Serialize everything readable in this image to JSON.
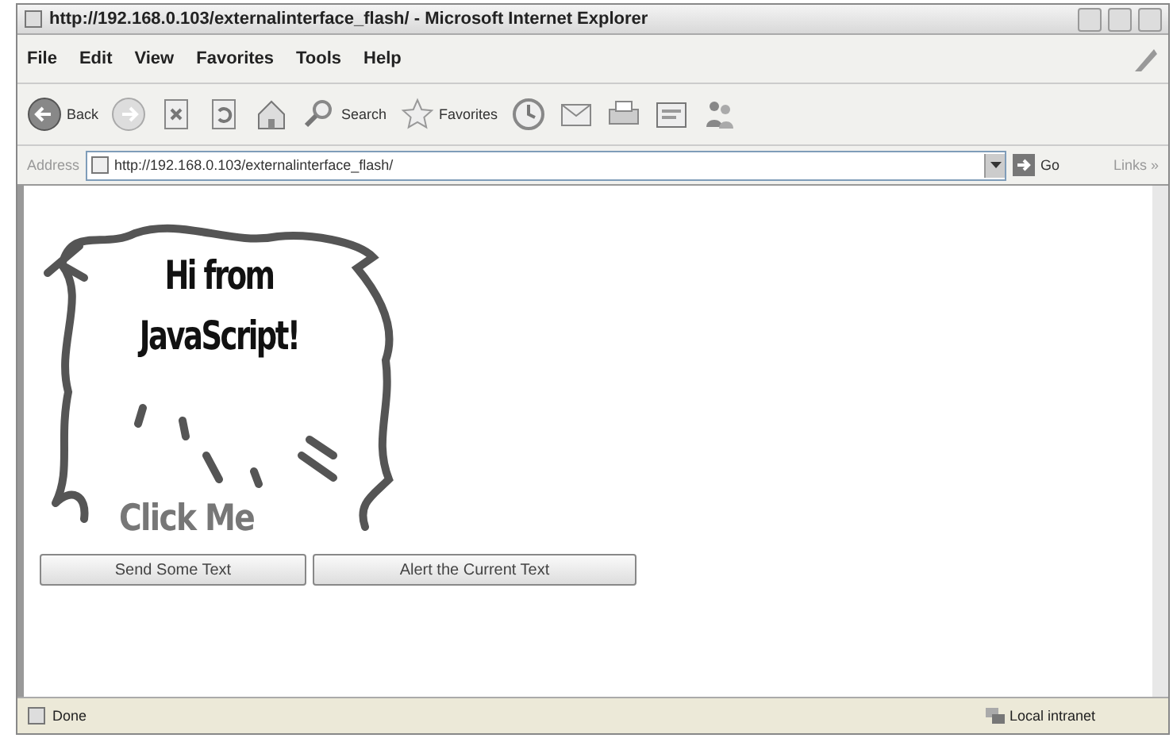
{
  "window": {
    "title": "http://192.168.0.103/externalinterface_flash/ - Microsoft Internet Explorer"
  },
  "menu": [
    "File",
    "Edit",
    "View",
    "Favorites",
    "Tools",
    "Help"
  ],
  "toolbar": [
    {
      "kind": "back",
      "label": "Back"
    },
    {
      "kind": "forward"
    },
    {
      "kind": "stop"
    },
    {
      "kind": "refresh"
    },
    {
      "kind": "home"
    },
    {
      "kind": "search",
      "label": "Search"
    },
    {
      "kind": "favorites",
      "label": "Favorites"
    },
    {
      "kind": "history"
    },
    {
      "kind": "mail"
    },
    {
      "kind": "print"
    },
    {
      "kind": "edit"
    },
    {
      "kind": "messenger"
    }
  ],
  "address": {
    "label": "Address",
    "value": "http://192.168.0.103/externalinterface_flash/",
    "go": "Go",
    "links": "Links »"
  },
  "flash": {
    "message": "Hi from JavaScript!",
    "click_label": "Click Me"
  },
  "buttons": [
    "Send Some Text",
    "Alert the Current Text"
  ],
  "status": {
    "text": "Done",
    "zone": "Local intranet"
  }
}
